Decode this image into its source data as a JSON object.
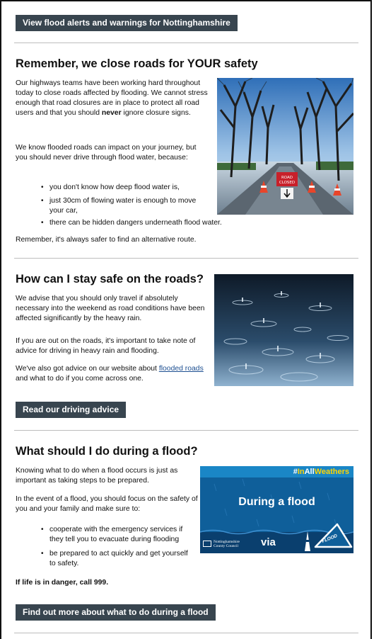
{
  "top_button": "View flood alerts and warnings for Nottinghamshire",
  "section1": {
    "heading": "Remember, we close roads for YOUR safety",
    "para1_part1": "Our highways teams have been working hard throughout today to close roads affected by flooding. We cannot stress enough that road closures are in place to protect all road users and that you should ",
    "para1_bold": "never",
    "para1_part2": " ignore closure signs.",
    "para2": "We know flooded roads can impact on your journey, but you should never drive through flood water, because:",
    "bullets": [
      "you don't know how deep flood water is,",
      "just 30cm of flowing water is enough to move your car,",
      "there can be hidden dangers underneath flood water."
    ],
    "closing": "Remember, it's always safer to find an alternative route.",
    "image_sign_text": "ROAD CLOSED"
  },
  "section2": {
    "heading": "How can I stay safe on the roads?",
    "para1": "We advise that you should only travel if absolutely necessary into the weekend as road conditions have been affected significantly by the heavy rain.",
    "para2": "If you are out on the roads, it's important to take note of advice for driving in heavy rain and flooding.",
    "para3_part1": "We've also got advice on our website about ",
    "para3_link": "flooded roads",
    "para3_part2": " and what to do if you come across one.",
    "button": "Read our driving advice"
  },
  "section3": {
    "heading": "What should I do during a flood?",
    "para1": "Knowing what to do when a flood occurs is just as important as taking steps to be prepared.",
    "para2": "In the event of a flood, you should focus on the safety of you and your family and make sure to:",
    "bullets": [
      "cooperate with the emergency services if they tell you to evacuate during flooding",
      "be prepared to act quickly and get yourself to safety."
    ],
    "emergency": "If life is in danger, call 999.",
    "button": "Find out more about what to do during a flood",
    "graphic": {
      "hashtag_prefix": "#",
      "hashtag_in": "In",
      "hashtag_all": "All",
      "hashtag_weathers": "Weathers",
      "title": "During a flood",
      "council_line1": "Nottinghamshire",
      "council_line2": "County Council",
      "via": "via",
      "sign_text": "FLOOD"
    }
  },
  "colors": {
    "button_bg": "#38454f",
    "link": "#1d4f91",
    "graphic_bg": "#0f5f9a",
    "hashtag_accent": "#ffd400"
  }
}
